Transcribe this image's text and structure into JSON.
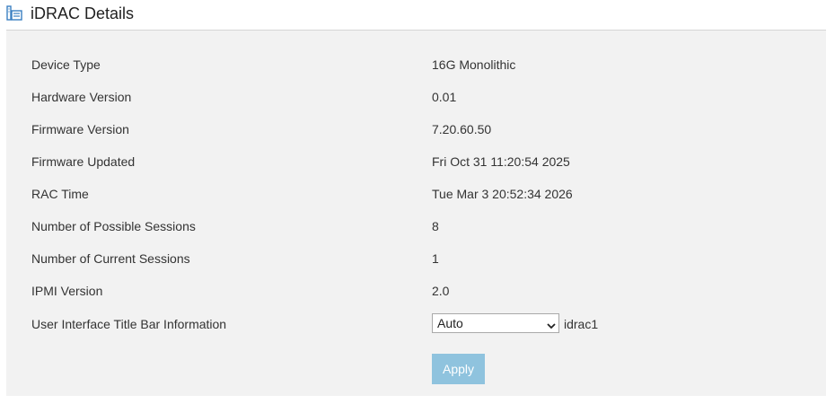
{
  "header": {
    "icon": "server-details-icon",
    "title": "iDRAC Details"
  },
  "details": {
    "device_type_label": "Device Type",
    "device_type_value": "16G Monolithic",
    "hardware_version_label": "Hardware Version",
    "hardware_version_value": "0.01",
    "firmware_version_label": "Firmware Version",
    "firmware_version_value": "7.20.60.50",
    "firmware_updated_label": "Firmware Updated",
    "firmware_updated_value": "Fri Oct 31 11:20:54 2025",
    "rac_time_label": "RAC Time",
    "rac_time_value": "Tue Mar 3 20:52:34 2026",
    "possible_sessions_label": "Number of Possible Sessions",
    "possible_sessions_value": "8",
    "current_sessions_label": "Number of Current Sessions",
    "current_sessions_value": "1",
    "ipmi_version_label": "IPMI Version",
    "ipmi_version_value": "2.0",
    "title_bar_label": "User Interface Title Bar Information",
    "title_bar_select_value": "Auto",
    "title_bar_suffix": "idrac1"
  },
  "actions": {
    "apply_label": "Apply"
  },
  "colors": {
    "accent_icon": "#3a7fc1",
    "apply_disabled": "#8fc3de",
    "panel_background": "#f2f2f2"
  }
}
